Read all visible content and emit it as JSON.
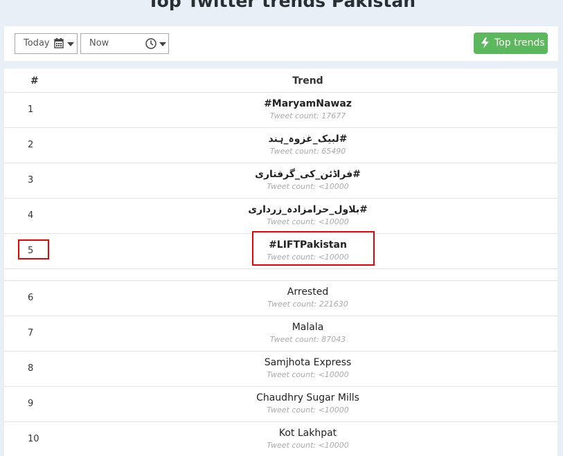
{
  "page": {
    "title": "Top Twitter trends Pakistan"
  },
  "controls": {
    "date_value": "Today",
    "time_value": "Now",
    "top_trends_label": "Top trends",
    "accent_color": "#5cb85c"
  },
  "table": {
    "col_rank": "#",
    "col_trend": "Trend",
    "rows": [
      {
        "rank": "1",
        "name": "#MaryamNawaz",
        "count": "Tweet count: 17677"
      },
      {
        "rank": "2",
        "name": "لبیک_غزوہ_ہند#",
        "count": "Tweet count: 65490"
      },
      {
        "rank": "3",
        "name": "فراڈئن_کی_گرفتاری#",
        "count": "Tweet count: <10000"
      },
      {
        "rank": "4",
        "name": "بلاول_حرامزادہ_زرداری#",
        "count": "Tweet count: <10000"
      },
      {
        "rank": "5",
        "name": "#LIFTPakistan",
        "count": "Tweet count: <10000"
      },
      {
        "rank": "6",
        "name": "Arrested",
        "count": "Tweet count: 221630"
      },
      {
        "rank": "7",
        "name": "Malala",
        "count": "Tweet count: 87043"
      },
      {
        "rank": "8",
        "name": "Samjhota Express",
        "count": "Tweet count: <10000"
      },
      {
        "rank": "9",
        "name": "Chaudhry Sugar Mills",
        "count": "Tweet count: <10000"
      },
      {
        "rank": "10",
        "name": "Kot Lakhpat",
        "count": "Tweet count: <10000"
      }
    ]
  },
  "highlight_color": "#e00000"
}
